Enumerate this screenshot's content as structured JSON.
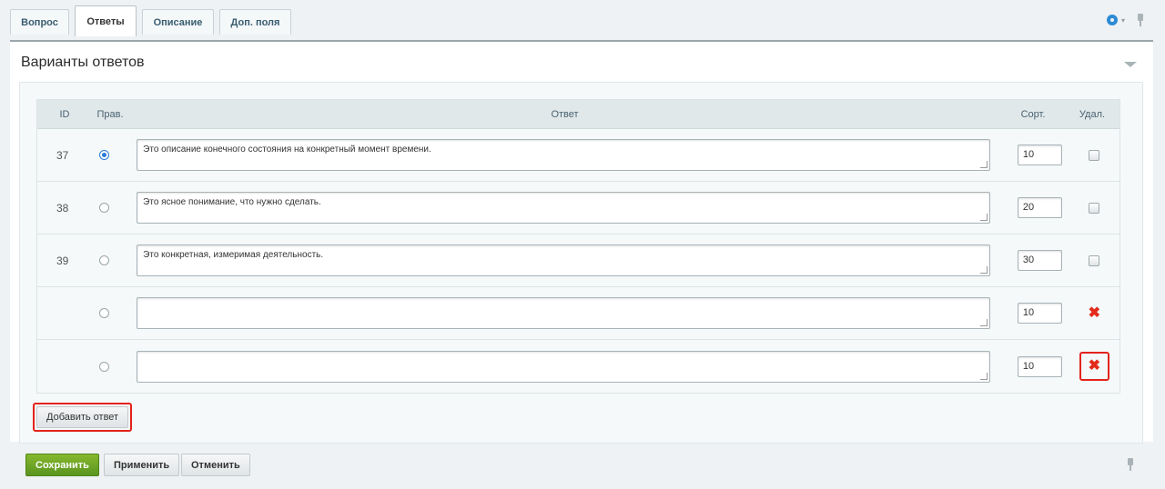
{
  "tabs": [
    {
      "label": "Вопрос",
      "active": false
    },
    {
      "label": "Ответы",
      "active": true
    },
    {
      "label": "Описание",
      "active": false
    },
    {
      "label": "Доп. поля",
      "active": false
    }
  ],
  "toolbar": {
    "settings_icon": "gear-icon",
    "pin_icon": "pin-icon"
  },
  "section": {
    "title": "Варианты ответов"
  },
  "table": {
    "headers": {
      "id": "ID",
      "correct": "Прав.",
      "answer": "Ответ",
      "sort": "Сорт.",
      "delete": "Удал."
    },
    "rows": [
      {
        "id": "37",
        "correct": true,
        "answer": "Это описание конечного состояния на конкретный момент времени.",
        "sort": "10",
        "delete": "checkbox"
      },
      {
        "id": "38",
        "correct": false,
        "answer": "Это ясное понимание, что нужно сделать.",
        "sort": "20",
        "delete": "checkbox"
      },
      {
        "id": "39",
        "correct": false,
        "answer": "Это конкретная, измеримая деятельность.",
        "sort": "30",
        "delete": "checkbox"
      },
      {
        "id": "",
        "correct": false,
        "answer": "",
        "sort": "10",
        "delete": "remove"
      },
      {
        "id": "",
        "correct": false,
        "answer": "",
        "sort": "10",
        "delete": "remove-highlighted"
      }
    ]
  },
  "add_button": {
    "label": "Добавить ответ"
  },
  "footer": {
    "save": "Сохранить",
    "apply": "Применить",
    "cancel": "Отменить"
  },
  "colors": {
    "save_button": "#5a9420",
    "highlight": "#e2231a",
    "accent": "#2a7ad8"
  }
}
